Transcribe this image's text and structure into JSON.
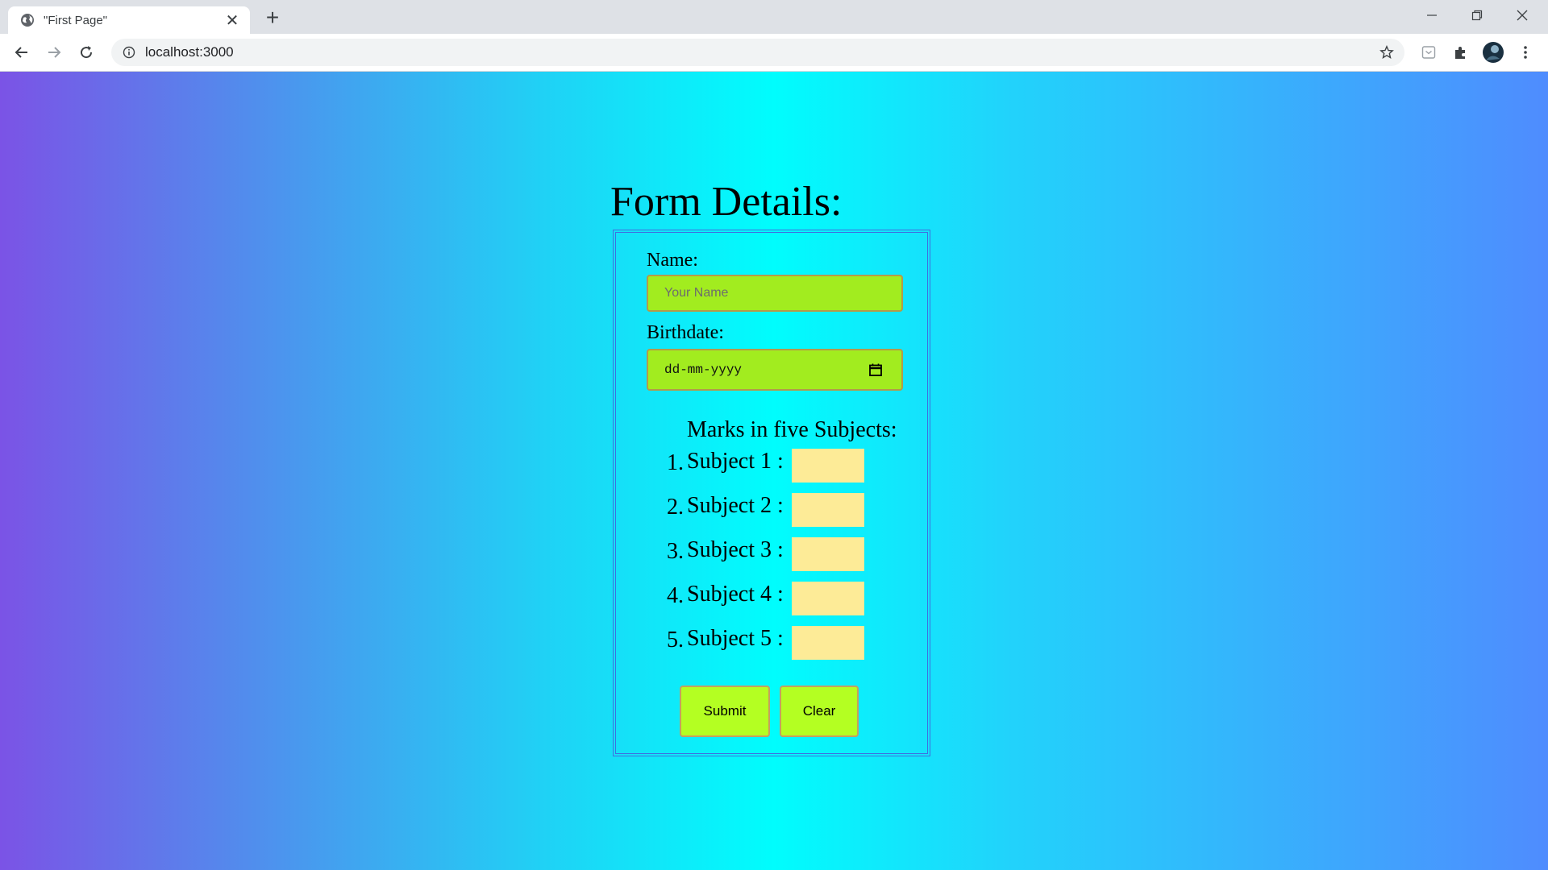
{
  "browser": {
    "tab_title": "\"First Page\"",
    "tab_close": "✕",
    "new_tab": "+",
    "url": "localhost:3000"
  },
  "page": {
    "heading": "Form Details:",
    "name_label": "Name:",
    "name_placeholder": "Your Name",
    "name_value": "",
    "birthdate_label": "Birthdate:",
    "birthdate_placeholder": "dd-mm-yyyy",
    "marks_title": "Marks in five Subjects:",
    "subjects": [
      {
        "num": "1.",
        "label": "Subject 1 :",
        "value": ""
      },
      {
        "num": "2.",
        "label": "Subject 2 :",
        "value": ""
      },
      {
        "num": "3.",
        "label": "Subject 3 :",
        "value": ""
      },
      {
        "num": "4.",
        "label": "Subject 4 :",
        "value": ""
      },
      {
        "num": "5.",
        "label": "Subject 5 :",
        "value": ""
      }
    ],
    "submit_label": "Submit",
    "clear_label": "Clear"
  },
  "colors": {
    "gradient_left": "#7b53e6",
    "gradient_center": "#00fdfd",
    "gradient_right": "#4f8cfe",
    "input_green": "#a2ec1f",
    "marks_input": "#fdeb97",
    "button_green": "#b4ff22",
    "form_border": "#3f6fe0"
  },
  "icons": [
    "globe-icon",
    "close-icon",
    "plus-icon",
    "minimize-icon",
    "restore-icon",
    "window-close-icon",
    "back-arrow-icon",
    "forward-arrow-icon",
    "reload-icon",
    "info-icon",
    "star-icon",
    "pocket-icon",
    "extensions-puzzle-icon",
    "profile-avatar-icon",
    "kebab-menu-icon",
    "calendar-icon"
  ]
}
